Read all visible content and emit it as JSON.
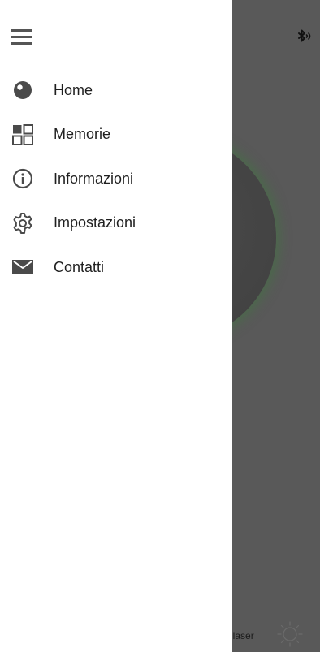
{
  "status": {
    "bluetooth_icon": "bluetooth-audio-icon"
  },
  "drawer": {
    "menu_icon": "hamburger-menu-icon",
    "items": [
      {
        "label": "Home",
        "icon": "home-circle-icon"
      },
      {
        "label": "Memorie",
        "icon": "memory-grid-icon"
      },
      {
        "label": "Informazioni",
        "icon": "info-icon"
      },
      {
        "label": "Impostazioni",
        "icon": "gear-icon"
      },
      {
        "label": "Contatti",
        "icon": "mail-icon"
      }
    ]
  },
  "background": {
    "laser_label": "ne laser",
    "sun_icon": "sun-icon",
    "accent_glow": "#3c7a3c",
    "overlay_color": "#595959"
  }
}
